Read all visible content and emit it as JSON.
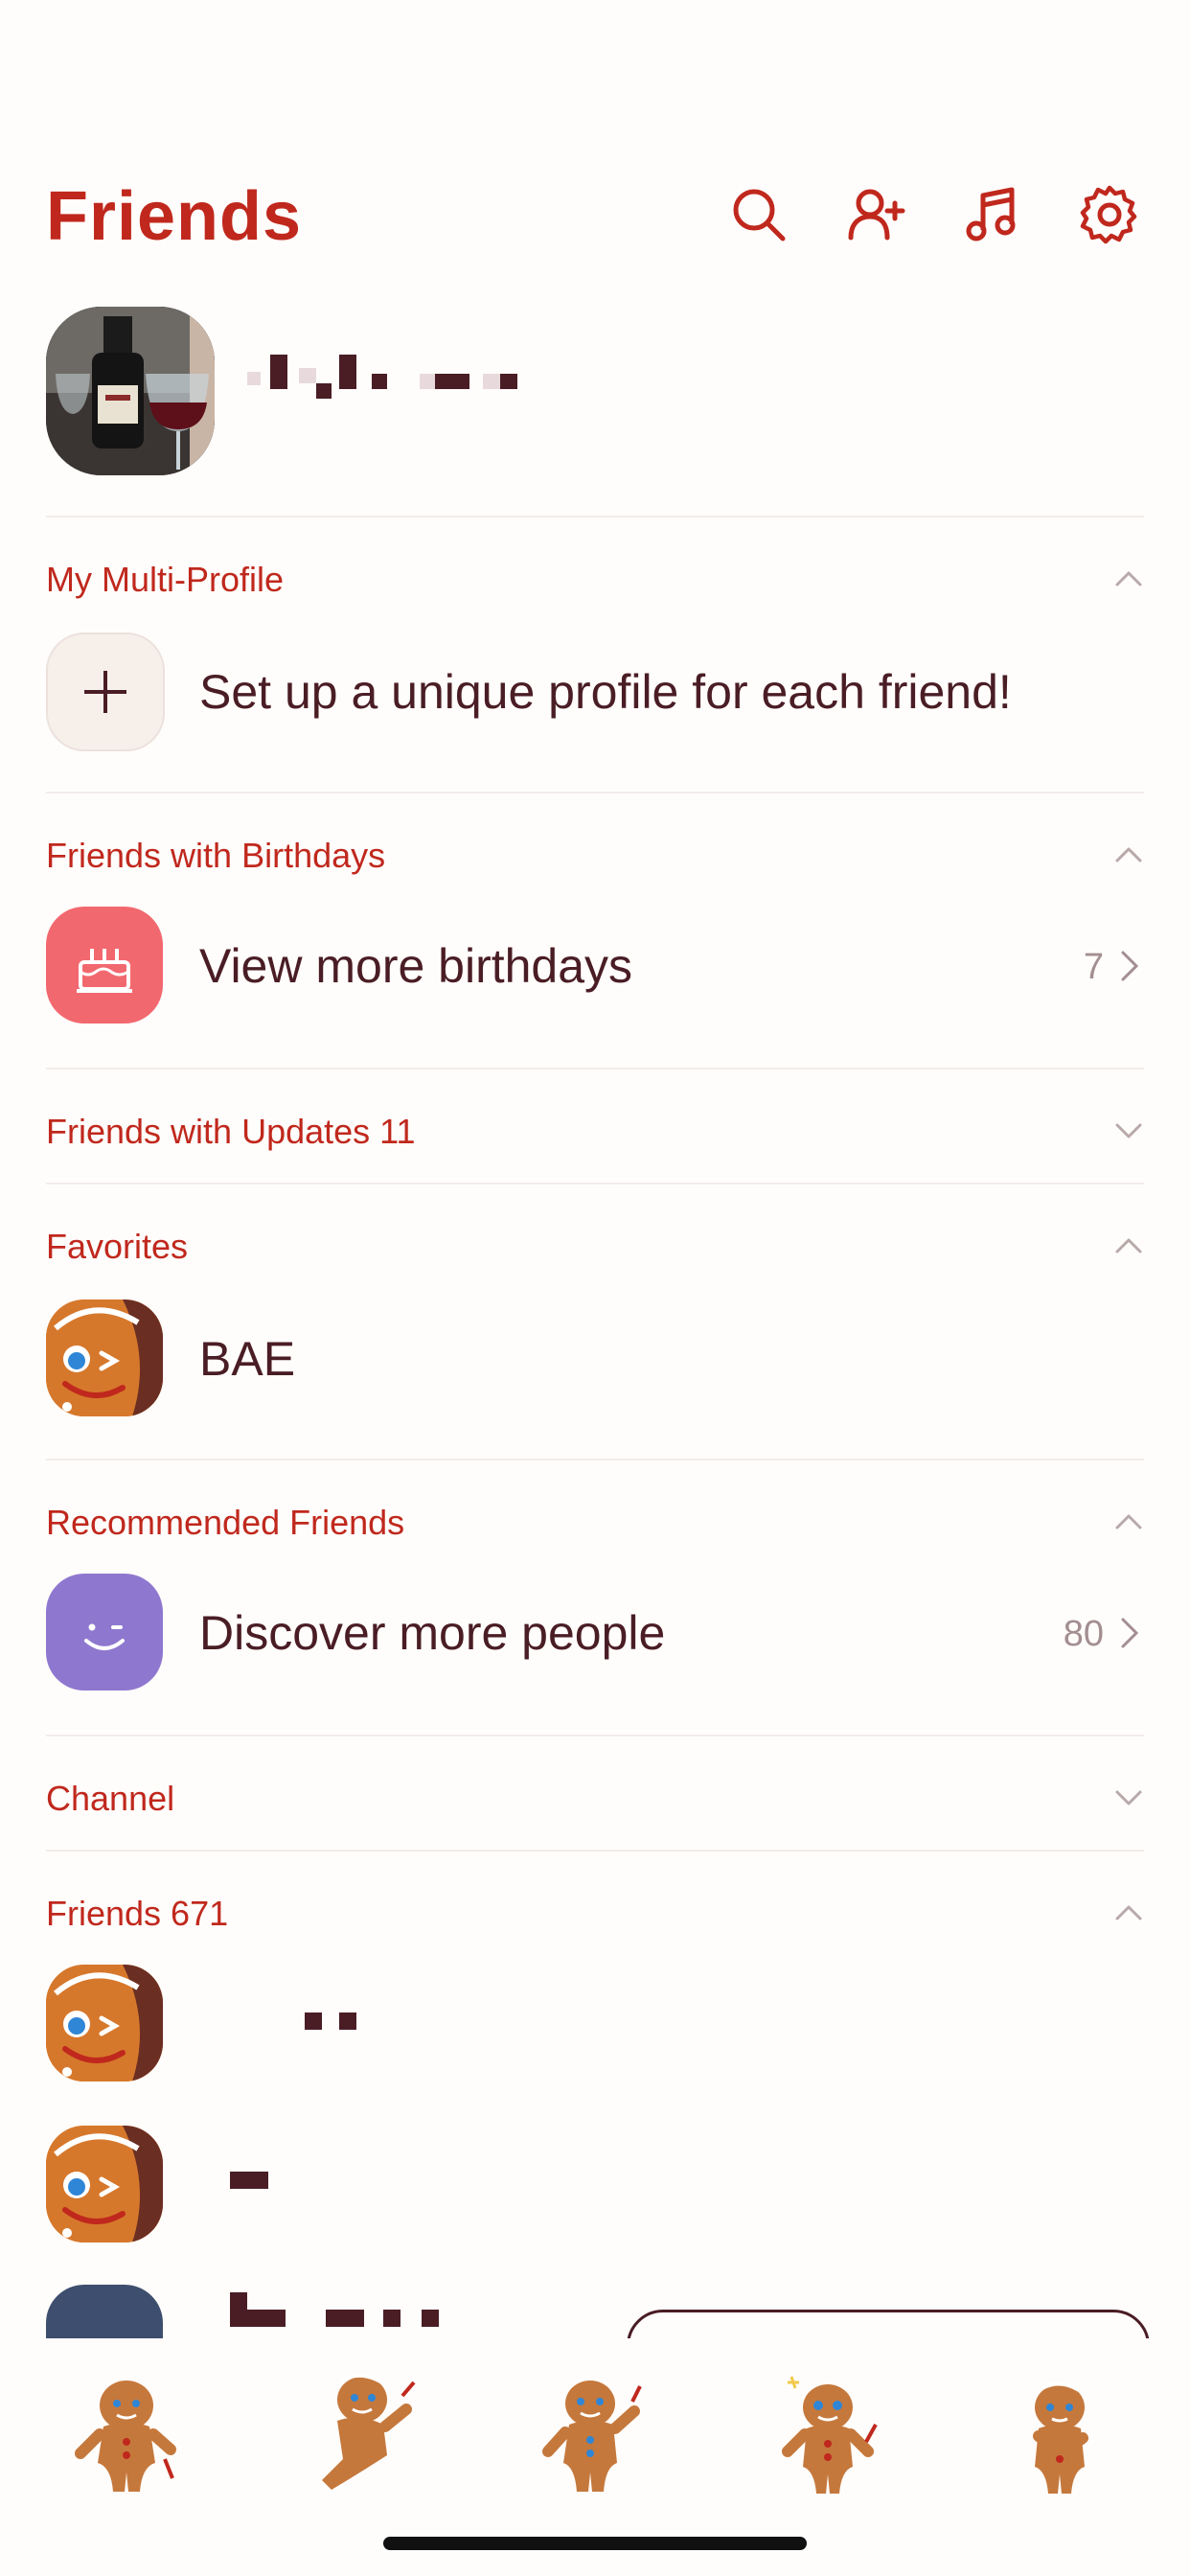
{
  "header": {
    "title": "Friends",
    "icons": [
      "search-icon",
      "add-friend-icon",
      "music-icon",
      "settings-icon"
    ]
  },
  "multi_profile": {
    "section_label": "My Multi-Profile",
    "row_text": "Set up a unique profile for each friend!"
  },
  "birthdays": {
    "section_label": "Friends with Birthdays",
    "row_text": "View more birthdays",
    "count": "7"
  },
  "updates": {
    "section_label": "Friends with Updates 11"
  },
  "favorites": {
    "section_label": "Favorites",
    "items": [
      {
        "name": "BAE"
      }
    ]
  },
  "recommended": {
    "section_label": "Recommended Friends",
    "row_text": "Discover more people",
    "count": "80"
  },
  "channel": {
    "section_label": "Channel"
  },
  "friends": {
    "section_label": "Friends 671"
  },
  "colors": {
    "accent": "#c0281d",
    "text": "#4a1d25",
    "birthday_icon_bg": "#f2686f",
    "discover_icon_bg": "#8e78cf",
    "background": "#fffdfb"
  }
}
